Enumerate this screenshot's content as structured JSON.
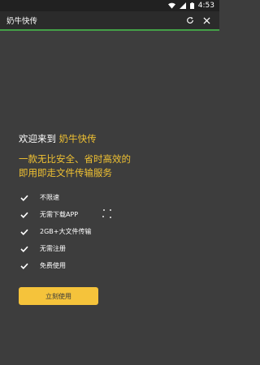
{
  "status_bar": {
    "time": "4:53",
    "icons": [
      "wifi-icon",
      "cellular-icon",
      "battery-icon"
    ]
  },
  "app_bar": {
    "title": "奶牛快传",
    "actions": [
      "refresh-icon",
      "close-icon"
    ]
  },
  "welcome": {
    "prefix": "欢迎来到 ",
    "brand": "奶牛快传"
  },
  "tagline": {
    "line1": "一款无比安全、省时高效的",
    "line2": "即用即走文件传输服务"
  },
  "features": [
    {
      "label": "不限速"
    },
    {
      "label": "无需下载APP"
    },
    {
      "label": "2GB+大文件传输"
    },
    {
      "label": "无需注册"
    },
    {
      "label": "免费使用"
    }
  ],
  "cta": {
    "label": "立刻使用"
  },
  "colors": {
    "background": "#3d3d3d",
    "accent": "#f1c232",
    "button": "#f5c33b",
    "progress": "#43a047"
  }
}
